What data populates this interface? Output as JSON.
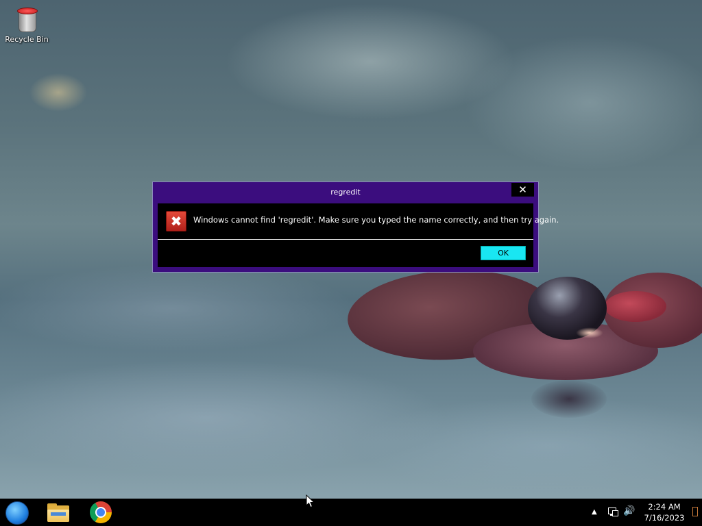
{
  "desktop": {
    "icons": [
      {
        "label": "Recycle Bin",
        "icon": "recycle-bin-icon"
      }
    ]
  },
  "dialog": {
    "title": "regredit",
    "close_glyph": "✕",
    "error_icon_glyph": "✖",
    "message": "Windows cannot find 'regredit'. Make sure you typed the name correctly, and then try again.",
    "ok_label": "OK"
  },
  "taskbar": {
    "start_icon": "windows-orb-icon",
    "pinned": [
      {
        "name": "File Explorer",
        "icon": "folder-icon"
      },
      {
        "name": "Google Chrome",
        "icon": "chrome-icon"
      }
    ],
    "tray": {
      "arrow_glyph": "▲",
      "volume_glyph": "🔊",
      "time": "2:24 AM",
      "date": "7/16/2023"
    }
  },
  "colors": {
    "dialog_frame": "#3b0d7e",
    "dialog_body": "#000000",
    "ok_button": "#19e6f2",
    "taskbar": "#000000"
  }
}
